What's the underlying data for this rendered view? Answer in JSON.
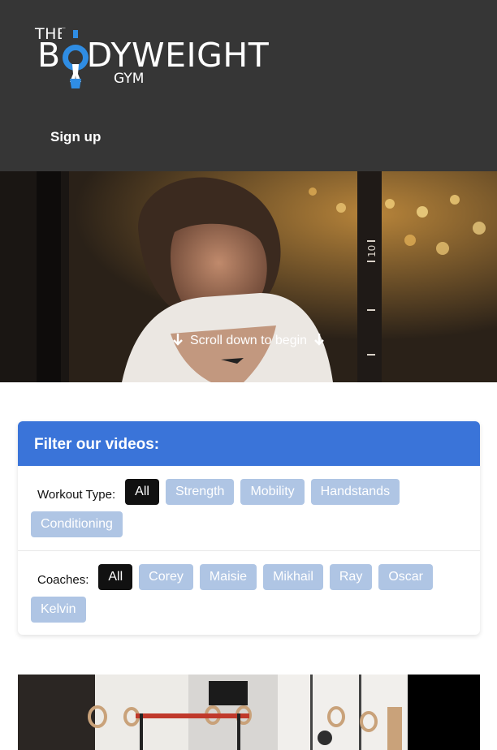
{
  "header": {
    "logo": {
      "the": "THE",
      "main": "BODYWEIGHT",
      "gym": "GYM",
      "accent": "#2f8de4"
    },
    "nav": {
      "signup_label": "Sign up"
    }
  },
  "hero": {
    "scroll_label": "Scroll down to begin",
    "rig_number": "10"
  },
  "filter": {
    "title": "Filter our videos:",
    "workout_type": {
      "label": "Workout Type:",
      "options": [
        "All",
        "Strength",
        "Mobility",
        "Handstands",
        "Conditioning"
      ]
    },
    "coaches": {
      "label": "Coaches:",
      "options": [
        "All",
        "Corey",
        "Maisie",
        "Mikhail",
        "Ray",
        "Oscar",
        "Kelvin"
      ]
    }
  },
  "colors": {
    "header_bg": "#363636",
    "filter_header": "#3a74d9",
    "chip_inactive": "#afc5e4",
    "chip_active": "#111111"
  }
}
